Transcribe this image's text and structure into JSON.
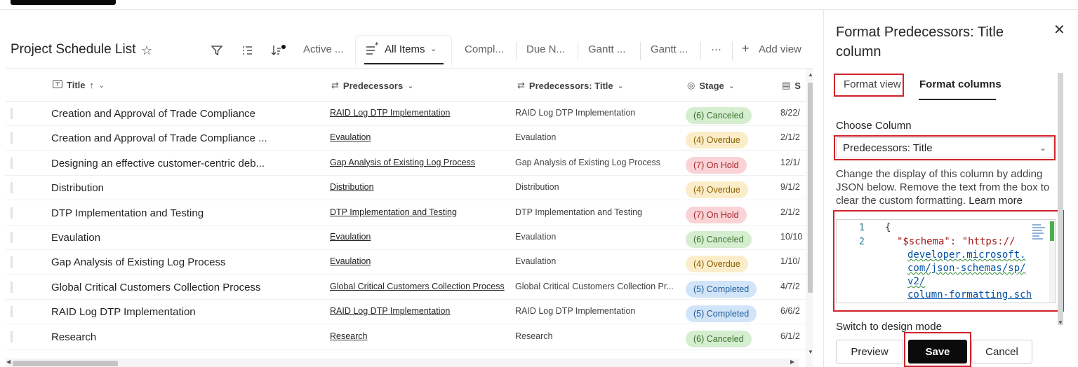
{
  "list": {
    "title": "Project Schedule List",
    "favorite_glyph": "☆"
  },
  "toolbar": {
    "views": [
      "Active ...",
      "All Items",
      "Compl...",
      "Due N...",
      "Gantt ...",
      "Gantt ..."
    ],
    "active_view": "All Items",
    "more": "···",
    "add_view": "Add view"
  },
  "columns": {
    "title": "Title",
    "predecessors": "Predecessors",
    "predecessors_title": "Predecessors: Title",
    "stage": "Stage",
    "next_initial": "S"
  },
  "rows": [
    {
      "title": "Creation and Approval of Trade Compliance",
      "pred": "RAID Log DTP Implementation",
      "pred_title": "RAID Log DTP Implementation",
      "stage": "(6) Canceled",
      "stage_kind": "canceled",
      "date": "8/22/"
    },
    {
      "title": "Creation and Approval of Trade Compliance ...",
      "pred": "Evaulation",
      "pred_title": "Evaulation",
      "stage": "(4) Overdue",
      "stage_kind": "overdue",
      "date": "2/1/2"
    },
    {
      "title": "Designing an effective customer-centric deb...",
      "pred": "Gap Analysis of Existing Log Process",
      "pred_title": "Gap Analysis of Existing Log Process",
      "stage": "(7) On Hold",
      "stage_kind": "onhold",
      "date": "12/1/"
    },
    {
      "title": "Distribution",
      "pred": "Distribution",
      "pred_title": "Distribution",
      "stage": "(4) Overdue",
      "stage_kind": "overdue",
      "date": "9/1/2"
    },
    {
      "title": "DTP Implementation and Testing",
      "pred": "DTP Implementation and Testing",
      "pred_title": "DTP Implementation and Testing",
      "stage": "(7) On Hold",
      "stage_kind": "onhold",
      "date": "2/1/2"
    },
    {
      "title": "Evaulation",
      "pred": "Evaulation",
      "pred_title": "Evaulation",
      "stage": "(6) Canceled",
      "stage_kind": "canceled",
      "date": "10/10"
    },
    {
      "title": "Gap Analysis of Existing Log Process",
      "pred": "Evaulation",
      "pred_title": "Evaulation",
      "stage": "(4) Overdue",
      "stage_kind": "overdue",
      "date": "1/10/"
    },
    {
      "title": "Global Critical Customers Collection Process",
      "pred": "Global Critical Customers Collection Process",
      "pred_title": "Global Critical Customers Collection Pr...",
      "stage": "(5) Completed",
      "stage_kind": "completed",
      "date": "4/7/2"
    },
    {
      "title": "RAID Log DTP Implementation",
      "pred": "RAID Log DTP Implementation",
      "pred_title": "RAID Log DTP Implementation",
      "stage": "(5) Completed",
      "stage_kind": "completed",
      "date": "6/6/2"
    },
    {
      "title": "Research",
      "pred": "Research",
      "pred_title": "Research",
      "stage": "(6) Canceled",
      "stage_kind": "canceled",
      "date": "6/1/2"
    }
  ],
  "pane": {
    "title": "Format Predecessors: Title column",
    "close": "✕",
    "tab_format_view": "Format view",
    "tab_format_columns": "Format columns",
    "choose_column_label": "Choose Column",
    "selected_column": "Predecessors: Title",
    "description": "Change the display of this column by adding JSON below. Remove the text from the box to clear the custom formatting.",
    "learn_more": "Learn more",
    "code_line_numbers": [
      "1",
      "2"
    ],
    "code_lines": [
      "{",
      "\"$schema\": \"https://",
      "developer.microsoft.",
      "com/json-schemas/sp/",
      "v2/",
      "column-formatting.sch"
    ],
    "switch_mode": "Switch to design mode",
    "preview": "Preview",
    "save": "Save",
    "cancel": "Cancel"
  },
  "colors": {
    "highlight_red": "#d1232a",
    "primary_button": "#0b0b0b"
  }
}
